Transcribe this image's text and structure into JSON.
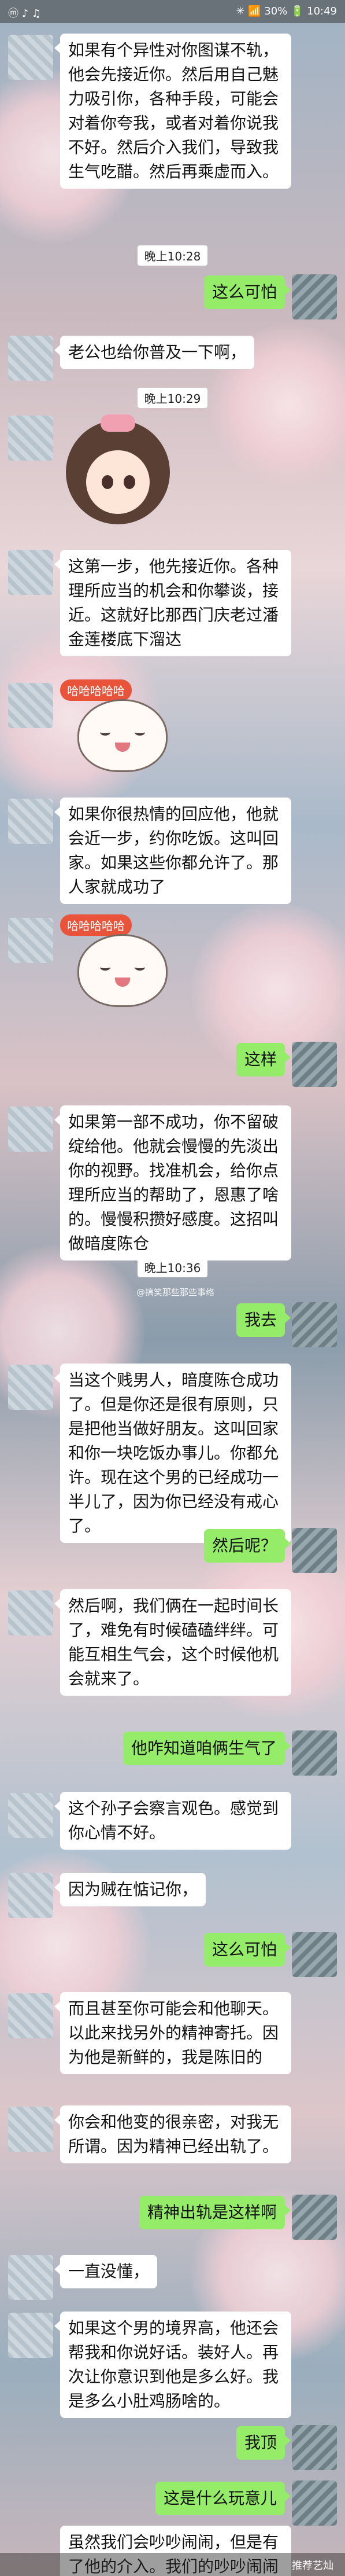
{
  "status_bar": {
    "left": "ⓜ ♪ ♫",
    "right": "✳ 📶 30% 🔋 10:49"
  },
  "timestamps": [
    "晚上10:28",
    "晚上10:29",
    "晚上10:36"
  ],
  "messages": [
    {
      "side": "in",
      "text": "如果有个异性对你图谋不轨，他会先接近你。然后用自己魅力吸引你，各种手段，可能会对着你夸我，或者对着你说我不好。然后介入我们，导致我生气吃醋。然后再乘虚而入。"
    },
    {
      "side": "out",
      "text": "这么可怕"
    },
    {
      "side": "in",
      "text": "老公也给你普及一下啊，"
    },
    {
      "side": "in",
      "text": "这第一步，他先接近你。各种理所应当的机会和你攀谈，接近。这就好比那西门庆老过潘金莲楼底下溜达"
    },
    {
      "side": "in",
      "text": "如果你很热情的回应他，他就会近一步，约你吃饭。这叫回家。如果这些你都允许了。那人家就成功了"
    },
    {
      "side": "out",
      "text": "这样"
    },
    {
      "side": "in",
      "text": "如果第一部不成功，你不留破绽给他。他就会慢慢的先淡出你的视野。找准机会，给你点理所应当的帮助了，恩惠了啥的。慢慢积攒好感度。这招叫做暗度陈仓"
    },
    {
      "side": "out",
      "text": "我去"
    },
    {
      "side": "in",
      "text": "当这个贱男人，暗度陈仓成功了。但是你还是很有原则，只是把他当做好朋友。这叫回家和你一块吃饭办事儿。你都允许。现在这个男的已经成功一半儿了，因为你已经没有戒心了。"
    },
    {
      "side": "out",
      "text": "然后呢？"
    },
    {
      "side": "in",
      "text": "然后啊，我们俩在一起时间长了，难免有时候磕磕绊绊。可能互相生气会，这个时候他机会就来了。"
    },
    {
      "side": "out",
      "text": "他咋知道咱俩生气了"
    },
    {
      "side": "in",
      "text": "这个孙子会察言观色。感觉到你心情不好。"
    },
    {
      "side": "in",
      "text": "因为贼在惦记你，"
    },
    {
      "side": "out",
      "text": "这么可怕"
    },
    {
      "side": "in",
      "text": "而且甚至你可能会和他聊天。以此来找另外的精神寄托。因为他是新鲜的，我是陈旧的"
    },
    {
      "side": "in",
      "text": "你会和他变的很亲密，对我无所谓。因为精神已经出轨了。"
    },
    {
      "side": "out",
      "text": "精神出轨是这样啊"
    },
    {
      "side": "in",
      "text": "一直没懂，"
    },
    {
      "side": "in",
      "text": "如果这个男的境界高，他还会帮我和你说好话。装好人。再次让你意识到他是多么好。我是多么小肚鸡肠啥的。"
    },
    {
      "side": "out",
      "text": "我顶"
    },
    {
      "side": "out",
      "text": "这是什么玩意儿"
    },
    {
      "side": "in",
      "text": "虽然我们会吵吵闹闹，但是有了他的介入。我们的吵吵闹闹就和好不了。然后最后一步。他就情故纵，假装自己很内疚。是因为自己，才让我们分开。故意疏远你。为了撇清自己。假装好人？"
    }
  ],
  "stickers": [
    {
      "caption": "哈哈哈哈哈"
    },
    {
      "caption": "哈哈哈哈哈"
    },
    {
      "caption": "哈哈"
    }
  ],
  "watermark": "@搞笑那些那些事络",
  "footer_watermark": "推荐艺灿"
}
